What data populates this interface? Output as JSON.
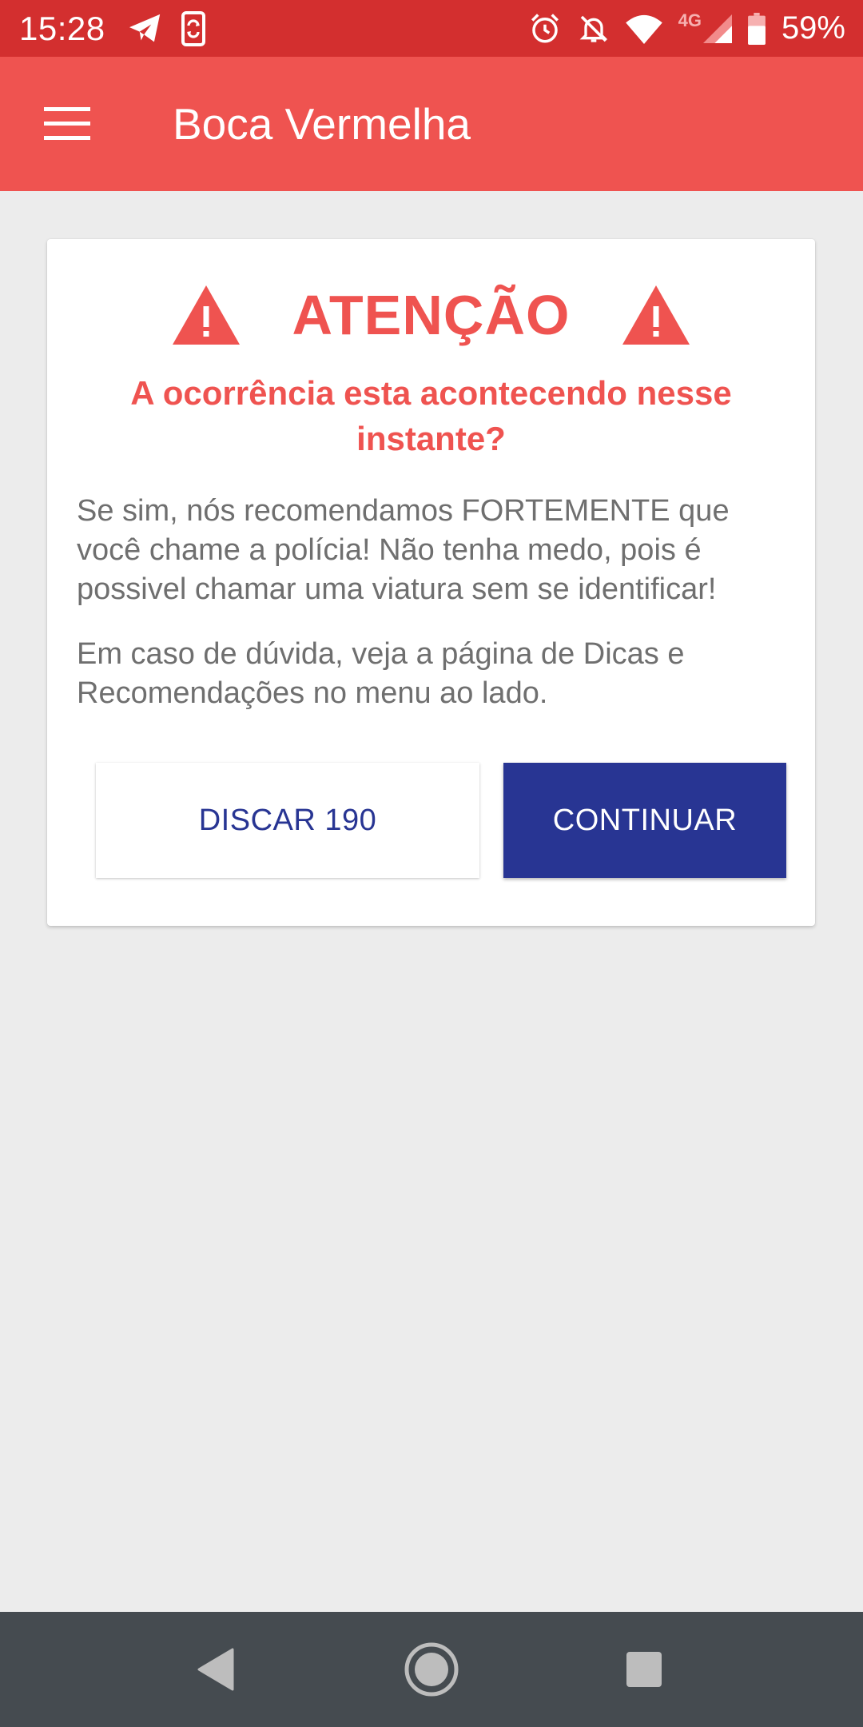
{
  "status_bar": {
    "time": "15:28",
    "network_label": "4G",
    "battery": "59%",
    "icons": [
      "telegram-icon",
      "phone-sync-icon",
      "alarm-icon",
      "bell-off-icon",
      "wifi-icon",
      "signal-icon",
      "battery-icon"
    ]
  },
  "app_bar": {
    "title": "Boca Vermelha",
    "menu_icon": "hamburger-menu-icon"
  },
  "alert": {
    "title": "ATENÇÃO",
    "question": "A ocorrência esta acontecendo nesse instante?",
    "paragraph_1": "Se sim, nós recomendamos FORTEMENTE que você chame a polícia! Não tenha medo, pois é possivel chamar uma viatura sem se identificar!",
    "paragraph_2": "Em caso de dúvida, veja a página de Dicas e Recomendações no menu ao lado.",
    "dial_button": "DISCAR 190",
    "continue_button": "CONTINUAR"
  },
  "colors": {
    "status_bar": "#d32f2f",
    "app_bar": "#ef5350",
    "accent_red": "#ef5350",
    "primary_blue": "#283593",
    "background": "#ececec",
    "nav_bar": "#454b50"
  }
}
